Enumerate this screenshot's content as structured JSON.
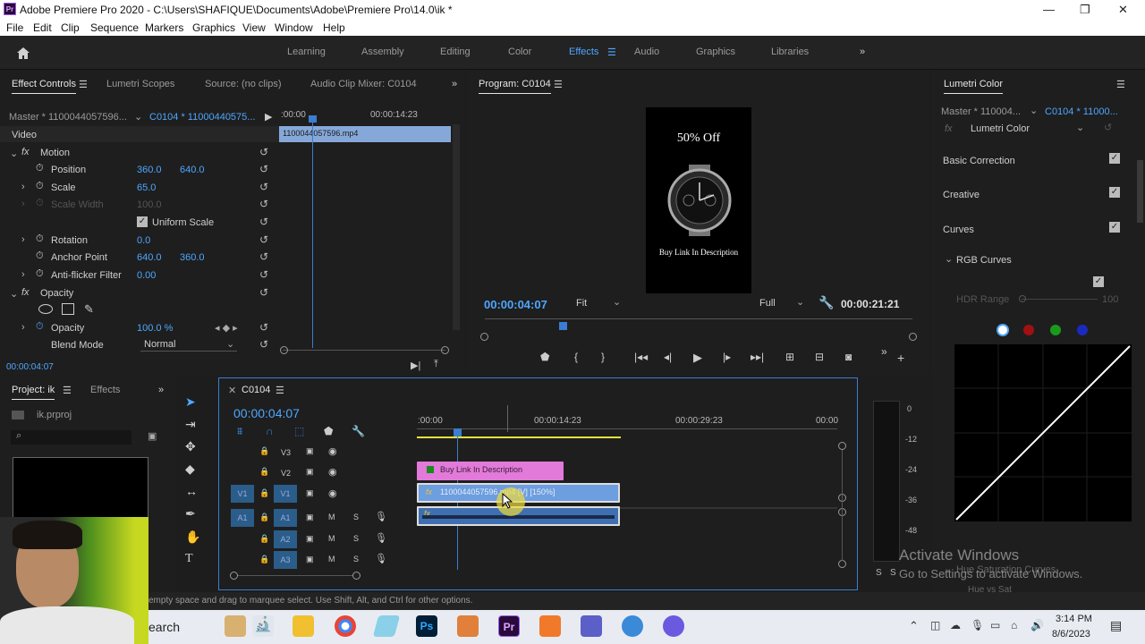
{
  "titlebar": {
    "app_icon": "Pr",
    "title": "Adobe Premiere Pro 2020 - C:\\Users\\SHAFIQUE\\Documents\\Adobe\\Premiere Pro\\14.0\\ik *",
    "minimize": "—",
    "restore": "❐",
    "close": "✕"
  },
  "menu": [
    "File",
    "Edit",
    "Clip",
    "Sequence",
    "Markers",
    "Graphics",
    "View",
    "Window",
    "Help"
  ],
  "workspaces": [
    "Learning",
    "Assembly",
    "Editing",
    "Color",
    "Effects",
    "Audio",
    "Graphics",
    "Libraries"
  ],
  "workspace_active": "Effects",
  "workspace_more": "»",
  "effect_controls": {
    "tabs": [
      "Effect Controls",
      "Lumetri Scopes",
      "Source: (no clips)",
      "Audio Clip Mixer: C0104"
    ],
    "master": "Master * 1100044057596...",
    "sequence_clip": "C0104 * 11000440575...",
    "time_start": ":00:00",
    "time_end": "00:00:14:23",
    "clip_name": "1100044057596.mp4",
    "video_label": "Video",
    "motion": "Motion",
    "position_label": "Position",
    "position_x": "360.0",
    "position_y": "640.0",
    "scale_label": "Scale",
    "scale": "65.0",
    "scale_width_label": "Scale Width",
    "scale_width": "100.0",
    "uniform_scale": "Uniform Scale",
    "rotation_label": "Rotation",
    "rotation": "0.0",
    "anchor_label": "Anchor Point",
    "anchor_x": "640.0",
    "anchor_y": "360.0",
    "antiflicker_label": "Anti-flicker Filter",
    "antiflicker": "0.00",
    "opacity_group": "Opacity",
    "opacity_label": "Opacity",
    "opacity": "100.0 %",
    "blend_label": "Blend Mode",
    "blend": "Normal",
    "timecode": "00:00:04:07"
  },
  "program": {
    "title": "Program: C0104",
    "overlay_top": "50% Off",
    "overlay_bottom": "Buy Link In Description",
    "timecode": "00:00:04:07",
    "fit": "Fit",
    "quality": "Full",
    "duration": "00:00:21:21"
  },
  "lumetri": {
    "title": "Lumetri Color",
    "master": "Master * 110004...",
    "clip": "C0104 * 11000...",
    "effect": "Lumetri Color",
    "sections": [
      "Basic Correction",
      "Creative",
      "Curves"
    ],
    "rgb_curves": "RGB Curves",
    "hdr_range": "HDR Range",
    "hdr_value": "100",
    "hue_sat": "Hue Saturation Curves",
    "hue_vs": "Hue vs Sat"
  },
  "project": {
    "tabs": [
      "Project: ik",
      "Effects"
    ],
    "file": "ik.prproj"
  },
  "timeline": {
    "sequence": "C0104",
    "timecode": "00:00:04:07",
    "ruler": [
      ":00:00",
      "00:00:14:23",
      "00:00:29:23",
      "00:00"
    ],
    "tracks": [
      {
        "name": "V3",
        "src": ""
      },
      {
        "name": "V2",
        "src": ""
      },
      {
        "name": "V1",
        "src": "V1"
      },
      {
        "name": "A1",
        "src": "A1"
      },
      {
        "name": "A2",
        "src": ""
      },
      {
        "name": "A3",
        "src": ""
      }
    ],
    "mute": "M",
    "solo": "S",
    "clip_v2": "Buy Link In Description",
    "clip_v1": "1100044057596.mp4 [V] [150%]",
    "meter_ticks": [
      "0",
      "-12",
      "-24",
      "-36",
      "-48"
    ],
    "meter_solo": "S",
    "meter_mute": "S"
  },
  "status": "empty space and drag to marquee select. Use Shift, Alt, and Ctrl for other options.",
  "watermark": {
    "line1": "Activate Windows",
    "line2": "Go to Settings to activate Windows."
  },
  "taskbar": {
    "search": "earch",
    "time": "3:14 PM",
    "date": "8/6/2023"
  },
  "colors": {
    "accent": "#4ea7ff",
    "v2_clip": "#e27ad9",
    "v1_clip": "#6c9ee0",
    "audio_clip": "#3f6fb1",
    "playhead": "#3a7dd1"
  }
}
